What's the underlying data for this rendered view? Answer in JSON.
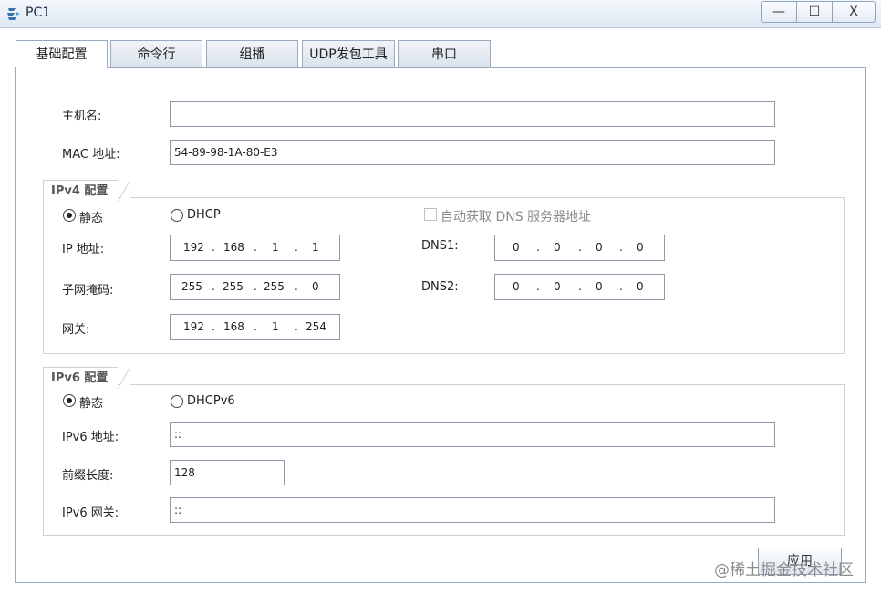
{
  "window": {
    "title": "PC1",
    "minimize": "—",
    "maximize": "☐",
    "close": "X"
  },
  "tabs": [
    {
      "label": "基础配置",
      "active": true
    },
    {
      "label": "命令行"
    },
    {
      "label": "组播"
    },
    {
      "label": "UDP发包工具"
    },
    {
      "label": "串口"
    }
  ],
  "basic": {
    "hostname_label": "主机名:",
    "hostname_value": "",
    "mac_label": "MAC 地址:",
    "mac_value": "54-89-98-1A-80-E3"
  },
  "ipv4": {
    "title": "IPv4 配置",
    "static_label": "静态",
    "dhcp_label": "DHCP",
    "auto_dns_label": "自动获取 DNS 服务器地址",
    "ip_label": "IP 地址:",
    "ip": [
      "192",
      "168",
      "1",
      "1"
    ],
    "mask_label": "子网掩码:",
    "mask": [
      "255",
      "255",
      "255",
      "0"
    ],
    "gateway_label": "网关:",
    "gateway": [
      "192",
      "168",
      "1",
      "254"
    ],
    "dns1_label": "DNS1:",
    "dns1": [
      "0",
      "0",
      "0",
      "0"
    ],
    "dns2_label": "DNS2:",
    "dns2": [
      "0",
      "0",
      "0",
      "0"
    ],
    "dot": "."
  },
  "ipv6": {
    "title": "IPv6 配置",
    "static_label": "静态",
    "dhcp_label": "DHCPv6",
    "addr_label": "IPv6 地址:",
    "addr_value": "::",
    "prefix_label": "前缀长度:",
    "prefix_value": "128",
    "gateway_label": "IPv6 网关:",
    "gateway_value": "::"
  },
  "apply_label": "应用",
  "watermark": "@稀土掘金技术社区",
  "colors": {
    "accent": "#3a6fb0",
    "border": "#98aac0"
  }
}
